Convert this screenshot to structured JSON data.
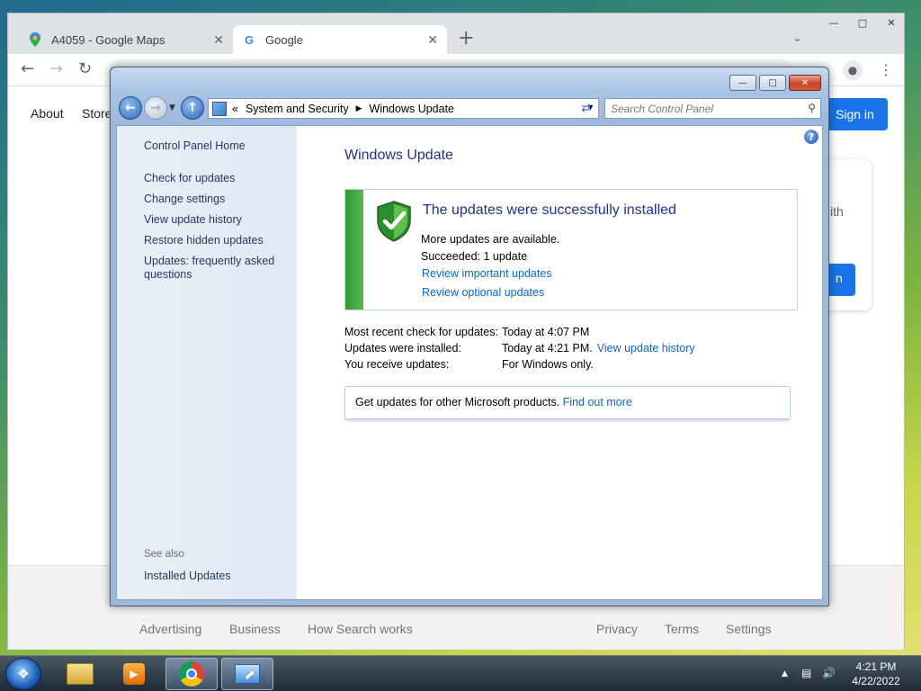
{
  "chrome": {
    "tabs": [
      {
        "title": "A4059 - Google Maps"
      },
      {
        "title": "Google"
      }
    ],
    "new_tab": "+",
    "close_glyph": "✕",
    "omnibox_text": "",
    "nav": {
      "about": "About",
      "store": "Store"
    },
    "signin": "Sign in",
    "card_text": "ith",
    "card_button": "n",
    "footer": {
      "advertising": "Advertising",
      "business": "Business",
      "how_search_works": "How Search works",
      "privacy": "Privacy",
      "terms": "Terms",
      "settings": "Settings"
    }
  },
  "control_panel": {
    "breadcrumb": {
      "prefix": "«",
      "level1": "System and Security",
      "level2": "Windows Update"
    },
    "search_placeholder": "Search Control Panel",
    "sidebar": {
      "home": "Control Panel Home",
      "items": [
        {
          "label": "Check for updates"
        },
        {
          "label": "Change settings"
        },
        {
          "label": "View update history"
        },
        {
          "label": "Restore hidden updates"
        },
        {
          "label": "Updates: frequently asked questions"
        }
      ],
      "see_also_title": "See also",
      "see_also_items": [
        {
          "label": "Installed Updates"
        }
      ]
    },
    "heading": "Windows Update",
    "status": {
      "title": "The updates were successfully installed",
      "line1": "More updates are available.",
      "line2": "Succeeded: 1 update",
      "link1": "Review important updates",
      "link2": "Review optional updates"
    },
    "info": {
      "recent_check_label": "Most recent check for updates:",
      "recent_check_value": "Today at 4:07 PM",
      "installed_label": "Updates were installed:",
      "installed_value": "Today at 4:21 PM.",
      "installed_link": "View update history",
      "receive_label": "You receive updates:",
      "receive_value": "For Windows only."
    },
    "other_products": {
      "text": "Get updates for other Microsoft products.",
      "link": "Find out more"
    }
  },
  "taskbar": {
    "time": "4:21 PM",
    "date": "4/22/2022"
  },
  "colors": {
    "link": "#0b66c8",
    "heading": "#1e3287",
    "success_bar": "#2f9b2f",
    "signin_blue": "#1a73e8"
  }
}
